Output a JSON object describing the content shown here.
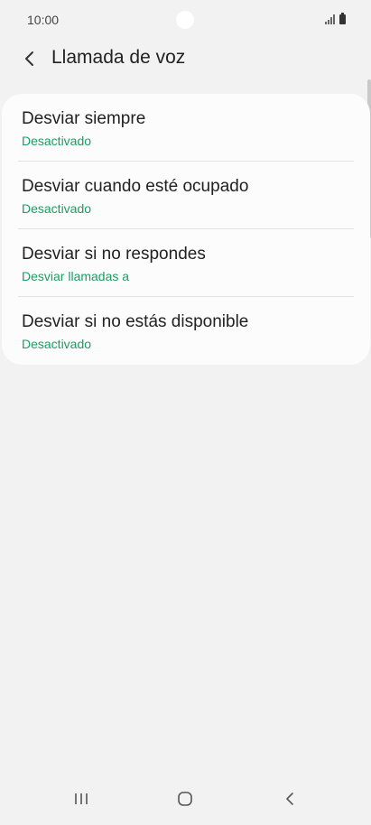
{
  "status_bar": {
    "time": "10:00",
    "icons": [
      "signal-icon",
      "battery-icon"
    ]
  },
  "header": {
    "back_icon": "chevron-left-icon",
    "title": "Llamada de voz"
  },
  "settings": {
    "items": [
      {
        "title": "Desviar siempre",
        "subtitle": "Desactivado"
      },
      {
        "title": "Desviar cuando esté ocupado",
        "subtitle": "Desactivado"
      },
      {
        "title": "Desviar si no respondes",
        "subtitle": "Desviar llamadas a"
      },
      {
        "title": "Desviar si no estás disponible",
        "subtitle": "Desactivado"
      }
    ]
  },
  "colors": {
    "accent": "#1a9e62",
    "background": "#f2f2f2",
    "card": "#fcfcfc"
  },
  "nav_bar": {
    "icons": [
      "recent-apps-icon",
      "home-icon",
      "back-icon"
    ]
  }
}
